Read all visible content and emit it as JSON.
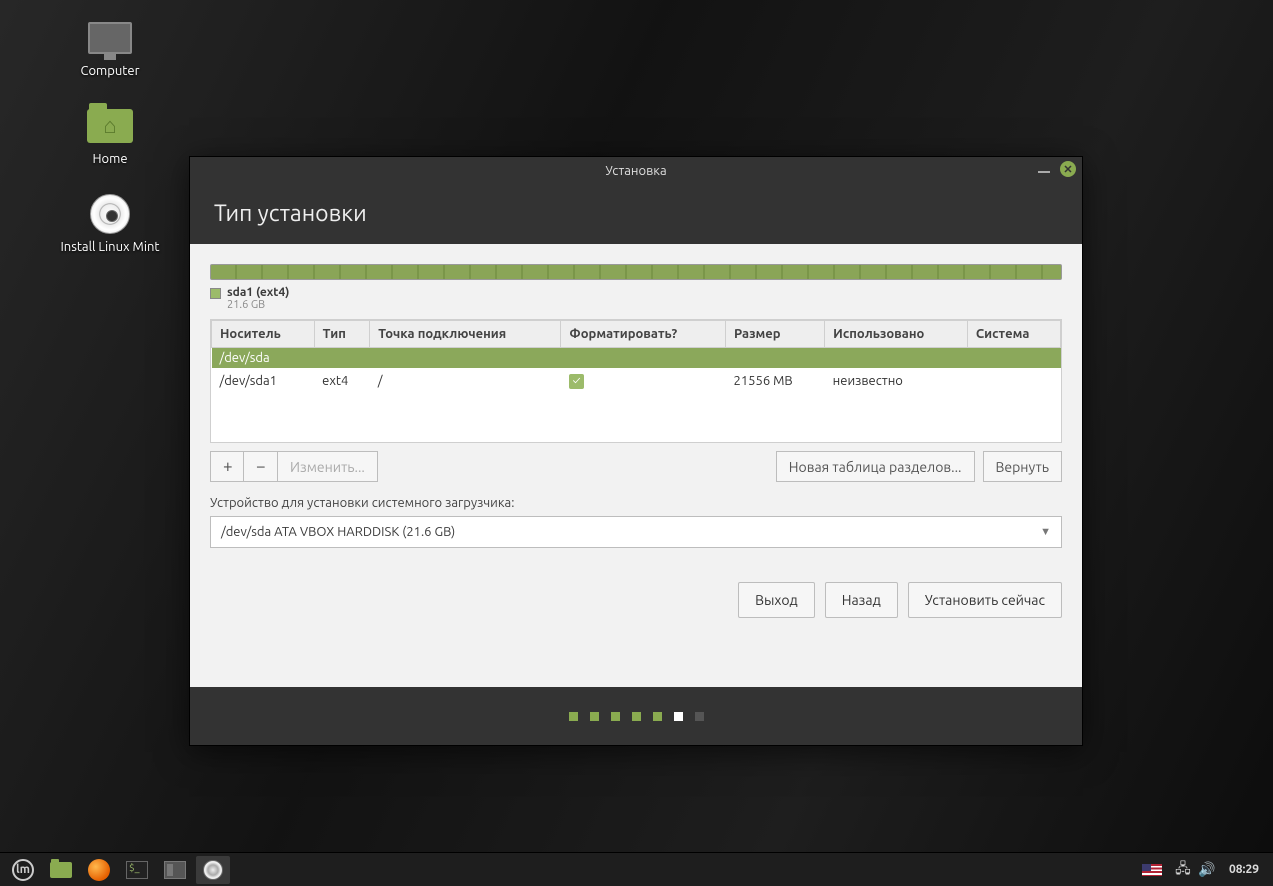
{
  "desktop_icons": {
    "computer": "Computer",
    "home": "Home",
    "install": "Install Linux Mint"
  },
  "window": {
    "title": "Установка",
    "heading": "Тип установки"
  },
  "disk_legend": {
    "name": "sda1 (ext4)",
    "size": "21.6 GB"
  },
  "table": {
    "headers": {
      "device": "Носитель",
      "type": "Тип",
      "mount": "Точка подключения",
      "format": "Форматировать?",
      "size": "Размер",
      "used": "Использовано",
      "system": "Система"
    },
    "disk_row": "/dev/sda",
    "partition": {
      "device": "/dev/sda1",
      "type": "ext4",
      "mount": "/",
      "size": "21556 MB",
      "used": "неизвестно",
      "system": ""
    }
  },
  "toolbar": {
    "add": "+",
    "remove": "−",
    "change": "Изменить...",
    "new_table": "Новая таблица разделов...",
    "revert": "Вернуть"
  },
  "bootloader": {
    "label": "Устройство для установки системного загрузчика:",
    "value": "/dev/sda   ATA VBOX HARDDISK (21.6 GB)"
  },
  "footer": {
    "quit": "Выход",
    "back": "Назад",
    "install": "Установить сейчас"
  },
  "taskbar": {
    "lang": "US",
    "clock": "08:29"
  }
}
